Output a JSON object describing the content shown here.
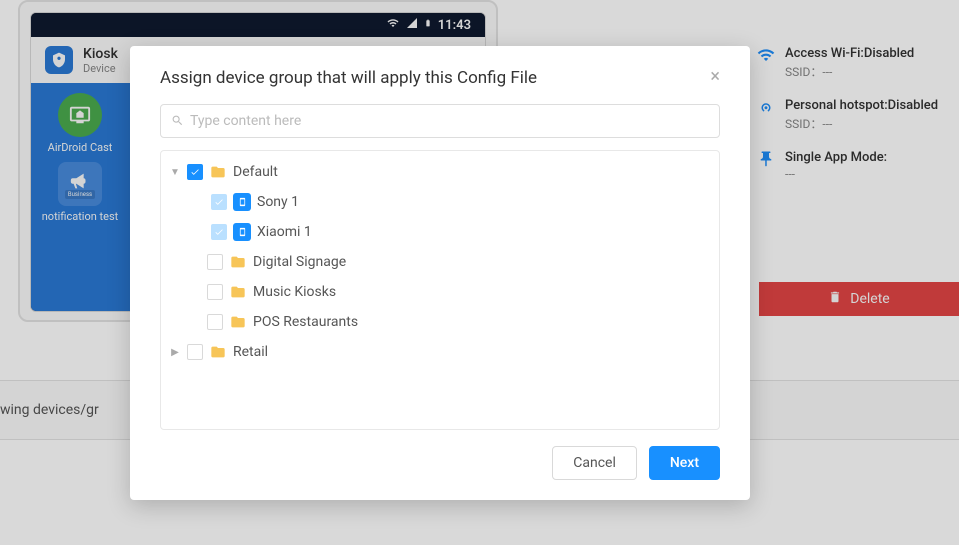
{
  "statusbar": {
    "time": "11:43"
  },
  "kiosk": {
    "title": "Kiosk",
    "subtitle": "Device"
  },
  "apps": {
    "airdroid": "AirDroid Cast",
    "notification": "notification test",
    "business_tag": "Business"
  },
  "info": {
    "wifi": {
      "label": "Access Wi-Fi:Disabled",
      "sub": "SSID：---"
    },
    "hotspot": {
      "label": "Personal hotspot:Disabled",
      "sub": "SSID：---"
    },
    "single_app": {
      "label": "Single App Mode:",
      "sub": "---"
    }
  },
  "delete_label": "Delete",
  "lower_bar_text": "wing devices/gr",
  "modal": {
    "title": "Assign device group that will apply this Config File",
    "search_placeholder": "Type content here",
    "cancel": "Cancel",
    "next": "Next"
  },
  "tree": {
    "default": "Default",
    "sony": "Sony 1",
    "xiaomi": "Xiaomi 1",
    "digital_signage": "Digital Signage",
    "music_kiosks": "Music Kiosks",
    "pos_restaurants": "POS Restaurants",
    "retail": "Retail"
  }
}
